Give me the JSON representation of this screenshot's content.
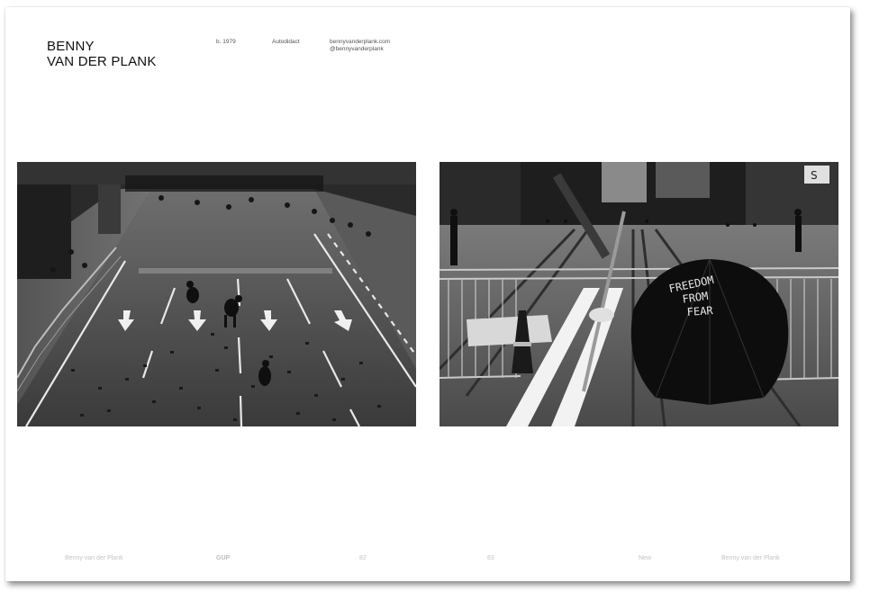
{
  "header": {
    "name_line1": "BENNY",
    "name_line2": "VAN DER PLANK",
    "born": "b. 1979",
    "education": "Autodidact",
    "website": "bennyvanderplank.com",
    "instagram": "@bennyvanderplank"
  },
  "photos": {
    "right_umbrella_text": [
      "FREEDOM",
      "FROM",
      "FEAR"
    ]
  },
  "footer": {
    "left_author": "Benny van der Plank",
    "left_publisher": "GUP",
    "left_page": "82",
    "right_page": "83",
    "right_section": "New",
    "right_author": "Benny van der Plank"
  }
}
